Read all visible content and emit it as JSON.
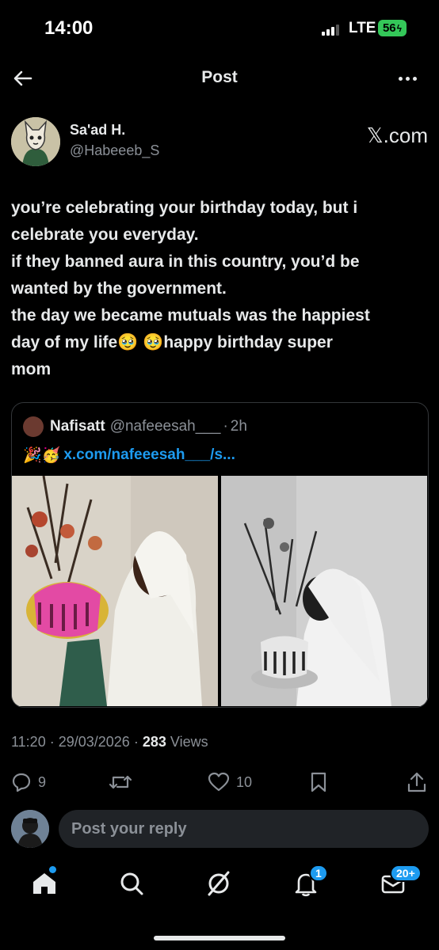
{
  "status_bar": {
    "time": "14:00",
    "network": "LTE",
    "battery": "56"
  },
  "nav": {
    "title": "Post",
    "back_icon": "arrow-left-icon",
    "more_icon": "ellipsis-icon"
  },
  "post": {
    "author_name": "Sa'ad H.",
    "author_handle": "@Habeeeb_S",
    "source": "𝕏.com",
    "text_lines": [
      "you’re celebrating your birthday today, but i",
      "celebrate you everyday.",
      "if they banned aura in this country, you’d be",
      "wanted by the government.",
      "the day we became mutuals was the happiest",
      "day of my life🥹 🥹happy birthday super",
      "mom"
    ],
    "time": "11:20",
    "date": "29/03/2026",
    "views_count": "283",
    "views_label": "Views"
  },
  "quote": {
    "name": "Nafisatt",
    "handle": "@nafeeesah___",
    "time": "2h",
    "emoji": "🎉🥳",
    "link": "x.com/nafeeesah___/s..."
  },
  "actions": {
    "replies": "9",
    "retweets": "",
    "likes": "10"
  },
  "reply": {
    "placeholder": "Post your reply"
  },
  "tabs": {
    "notifications_badge": "1",
    "messages_badge": "20+"
  },
  "colors": {
    "accent": "#1d9bf0",
    "background": "#000000",
    "secondary_text": "#8b9097",
    "battery": "#34c759"
  }
}
